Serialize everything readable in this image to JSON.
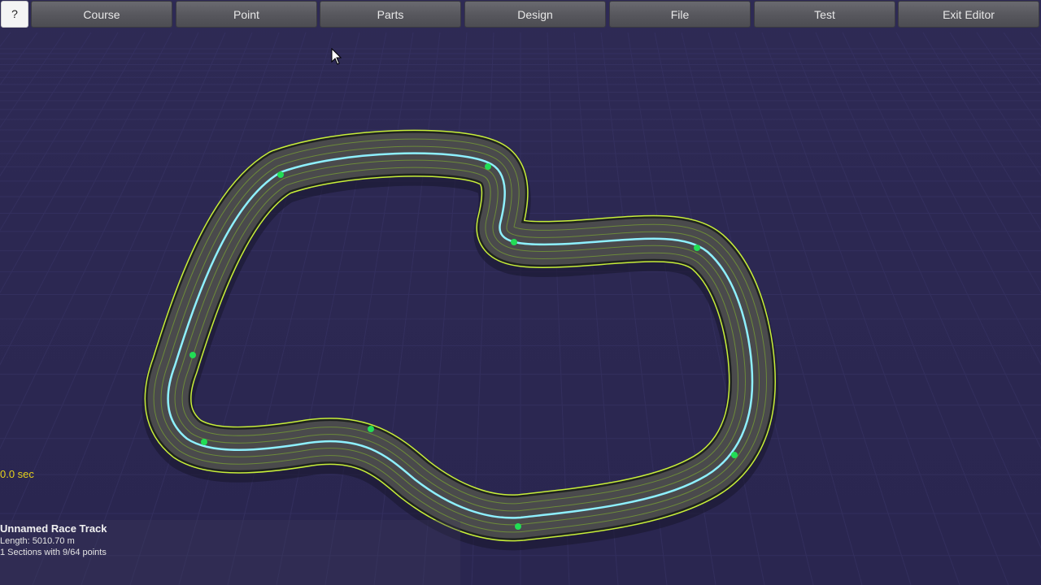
{
  "toolbar": {
    "help_label": "?",
    "buttons": [
      {
        "label": "Course"
      },
      {
        "label": "Point"
      },
      {
        "label": "Parts"
      },
      {
        "label": "Design"
      },
      {
        "label": "File"
      },
      {
        "label": "Test"
      },
      {
        "label": "Exit Editor"
      }
    ]
  },
  "timer": "0.0 sec",
  "track_info": {
    "name": "Unnamed Race Track",
    "length": "Length: 5010.70 m",
    "sections": "1 Sections with 9/64 points"
  },
  "control_points_count": 9,
  "colors": {
    "background": "#2c2852",
    "track_surface": "#4a4a4c",
    "track_edge_highlight": "#c8ef3a",
    "center_line": "#8ef0ff",
    "control_point": "#22dd55",
    "timer_text": "#e6d21a"
  }
}
